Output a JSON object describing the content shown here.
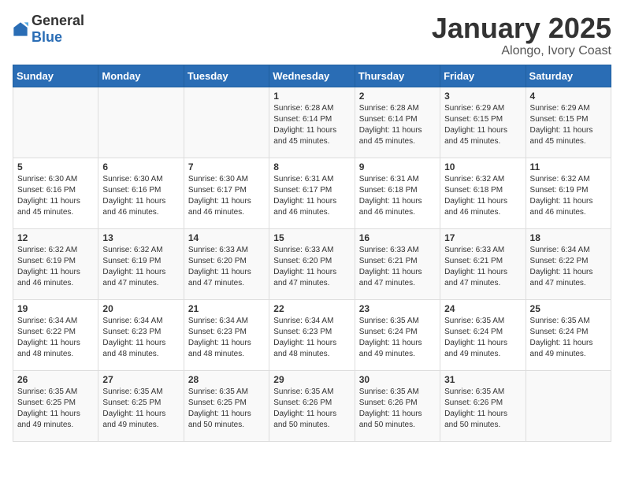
{
  "header": {
    "logo_general": "General",
    "logo_blue": "Blue",
    "month": "January 2025",
    "location": "Alongo, Ivory Coast"
  },
  "days_of_week": [
    "Sunday",
    "Monday",
    "Tuesday",
    "Wednesday",
    "Thursday",
    "Friday",
    "Saturday"
  ],
  "weeks": [
    [
      {
        "day": "",
        "content": ""
      },
      {
        "day": "",
        "content": ""
      },
      {
        "day": "",
        "content": ""
      },
      {
        "day": "1",
        "content": "Sunrise: 6:28 AM\nSunset: 6:14 PM\nDaylight: 11 hours and 45 minutes."
      },
      {
        "day": "2",
        "content": "Sunrise: 6:28 AM\nSunset: 6:14 PM\nDaylight: 11 hours and 45 minutes."
      },
      {
        "day": "3",
        "content": "Sunrise: 6:29 AM\nSunset: 6:15 PM\nDaylight: 11 hours and 45 minutes."
      },
      {
        "day": "4",
        "content": "Sunrise: 6:29 AM\nSunset: 6:15 PM\nDaylight: 11 hours and 45 minutes."
      }
    ],
    [
      {
        "day": "5",
        "content": "Sunrise: 6:30 AM\nSunset: 6:16 PM\nDaylight: 11 hours and 45 minutes."
      },
      {
        "day": "6",
        "content": "Sunrise: 6:30 AM\nSunset: 6:16 PM\nDaylight: 11 hours and 46 minutes."
      },
      {
        "day": "7",
        "content": "Sunrise: 6:30 AM\nSunset: 6:17 PM\nDaylight: 11 hours and 46 minutes."
      },
      {
        "day": "8",
        "content": "Sunrise: 6:31 AM\nSunset: 6:17 PM\nDaylight: 11 hours and 46 minutes."
      },
      {
        "day": "9",
        "content": "Sunrise: 6:31 AM\nSunset: 6:18 PM\nDaylight: 11 hours and 46 minutes."
      },
      {
        "day": "10",
        "content": "Sunrise: 6:32 AM\nSunset: 6:18 PM\nDaylight: 11 hours and 46 minutes."
      },
      {
        "day": "11",
        "content": "Sunrise: 6:32 AM\nSunset: 6:19 PM\nDaylight: 11 hours and 46 minutes."
      }
    ],
    [
      {
        "day": "12",
        "content": "Sunrise: 6:32 AM\nSunset: 6:19 PM\nDaylight: 11 hours and 46 minutes."
      },
      {
        "day": "13",
        "content": "Sunrise: 6:32 AM\nSunset: 6:19 PM\nDaylight: 11 hours and 47 minutes."
      },
      {
        "day": "14",
        "content": "Sunrise: 6:33 AM\nSunset: 6:20 PM\nDaylight: 11 hours and 47 minutes."
      },
      {
        "day": "15",
        "content": "Sunrise: 6:33 AM\nSunset: 6:20 PM\nDaylight: 11 hours and 47 minutes."
      },
      {
        "day": "16",
        "content": "Sunrise: 6:33 AM\nSunset: 6:21 PM\nDaylight: 11 hours and 47 minutes."
      },
      {
        "day": "17",
        "content": "Sunrise: 6:33 AM\nSunset: 6:21 PM\nDaylight: 11 hours and 47 minutes."
      },
      {
        "day": "18",
        "content": "Sunrise: 6:34 AM\nSunset: 6:22 PM\nDaylight: 11 hours and 47 minutes."
      }
    ],
    [
      {
        "day": "19",
        "content": "Sunrise: 6:34 AM\nSunset: 6:22 PM\nDaylight: 11 hours and 48 minutes."
      },
      {
        "day": "20",
        "content": "Sunrise: 6:34 AM\nSunset: 6:23 PM\nDaylight: 11 hours and 48 minutes."
      },
      {
        "day": "21",
        "content": "Sunrise: 6:34 AM\nSunset: 6:23 PM\nDaylight: 11 hours and 48 minutes."
      },
      {
        "day": "22",
        "content": "Sunrise: 6:34 AM\nSunset: 6:23 PM\nDaylight: 11 hours and 48 minutes."
      },
      {
        "day": "23",
        "content": "Sunrise: 6:35 AM\nSunset: 6:24 PM\nDaylight: 11 hours and 49 minutes."
      },
      {
        "day": "24",
        "content": "Sunrise: 6:35 AM\nSunset: 6:24 PM\nDaylight: 11 hours and 49 minutes."
      },
      {
        "day": "25",
        "content": "Sunrise: 6:35 AM\nSunset: 6:24 PM\nDaylight: 11 hours and 49 minutes."
      }
    ],
    [
      {
        "day": "26",
        "content": "Sunrise: 6:35 AM\nSunset: 6:25 PM\nDaylight: 11 hours and 49 minutes."
      },
      {
        "day": "27",
        "content": "Sunrise: 6:35 AM\nSunset: 6:25 PM\nDaylight: 11 hours and 49 minutes."
      },
      {
        "day": "28",
        "content": "Sunrise: 6:35 AM\nSunset: 6:25 PM\nDaylight: 11 hours and 50 minutes."
      },
      {
        "day": "29",
        "content": "Sunrise: 6:35 AM\nSunset: 6:26 PM\nDaylight: 11 hours and 50 minutes."
      },
      {
        "day": "30",
        "content": "Sunrise: 6:35 AM\nSunset: 6:26 PM\nDaylight: 11 hours and 50 minutes."
      },
      {
        "day": "31",
        "content": "Sunrise: 6:35 AM\nSunset: 6:26 PM\nDaylight: 11 hours and 50 minutes."
      },
      {
        "day": "",
        "content": ""
      }
    ]
  ]
}
